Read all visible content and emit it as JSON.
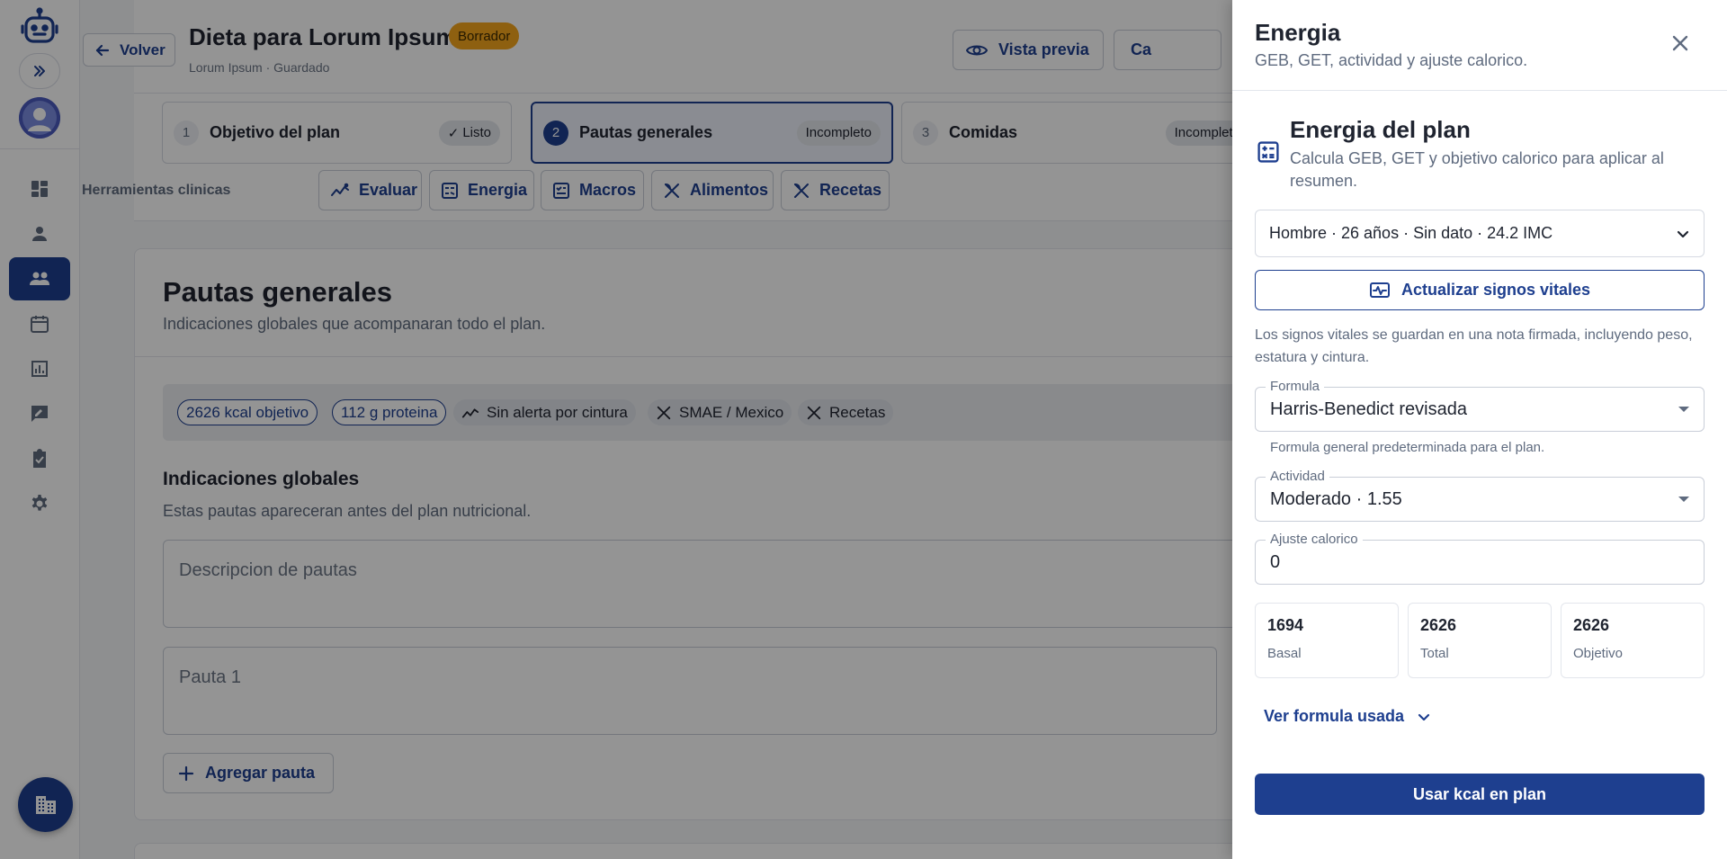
{
  "header": {
    "back_label": "Volver",
    "title": "Dieta para Lorum Ipsum",
    "status_badge": "Borrador",
    "subtitle": "Lorum Ipsum · Guardado",
    "preview_label": "Vista previa",
    "second_action_label": "Ca"
  },
  "steps": [
    {
      "number": "1",
      "label": "Objetivo del plan",
      "status": "Listo",
      "status_icon": "check-icon"
    },
    {
      "number": "2",
      "label": "Pautas generales",
      "status": "Incompleto"
    },
    {
      "number": "3",
      "label": "Comidas",
      "status": "Incompleto"
    }
  ],
  "tools": {
    "label": "Herramientas clinicas",
    "items": [
      {
        "label": "Evaluar",
        "icon": "trend-icon"
      },
      {
        "label": "Energia",
        "icon": "calculator-icon"
      },
      {
        "label": "Macros",
        "icon": "macros-icon"
      },
      {
        "label": "Alimentos",
        "icon": "utensils-icon"
      },
      {
        "label": "Recetas",
        "icon": "utensils-icon"
      }
    ]
  },
  "section": {
    "title": "Pautas generales",
    "subtitle": "Indicaciones globales que acompanaran todo el plan."
  },
  "chips": [
    {
      "label": "2626 kcal objetivo"
    },
    {
      "label": "112 g proteina"
    },
    {
      "label": "Sin alerta por cintura",
      "icon": "trend-icon"
    },
    {
      "label": "SMAE / Mexico",
      "icon": "utensils-icon"
    },
    {
      "label": "Recetas",
      "icon": "utensils-icon"
    }
  ],
  "global_indications": {
    "title": "Indicaciones globales",
    "subtitle": "Estas pautas apareceran antes del plan nutricional.",
    "description_placeholder": "Descripcion de pautas",
    "pauta_placeholder": "Pauta 1",
    "add_label": "Agregar pauta"
  },
  "drawer": {
    "title": "Energia",
    "subtitle": "GEB, GET, actividad y ajuste calorico.",
    "plan_title": "Energia del plan",
    "plan_subtitle": "Calcula GEB, GET y objetivo calorico para aplicar al resumen.",
    "patient_summary": "Hombre · 26 años · Sin dato · 24.2 IMC",
    "vitals_button": "Actualizar signos vitales",
    "vitals_note": "Los signos vitales se guardan en una nota firmada, incluyendo peso, estatura y cintura.",
    "formula": {
      "label": "Formula",
      "value": "Harris-Benedict revisada",
      "helper": "Formula general predeterminada para el plan."
    },
    "activity": {
      "label": "Actividad",
      "value": "Moderado · 1.55"
    },
    "adjustment": {
      "label": "Ajuste calorico",
      "value": "0"
    },
    "stats": [
      {
        "value": "1694",
        "label": "Basal"
      },
      {
        "value": "2626",
        "label": "Total"
      },
      {
        "value": "2626",
        "label": "Objetivo"
      }
    ],
    "formula_link": "Ver formula usada",
    "use_button": "Usar kcal en plan"
  },
  "colors": {
    "primary": "#1e3f8f",
    "draft_badge": "#f4a51c",
    "overlay": "rgba(0,0,0,0.42)"
  }
}
